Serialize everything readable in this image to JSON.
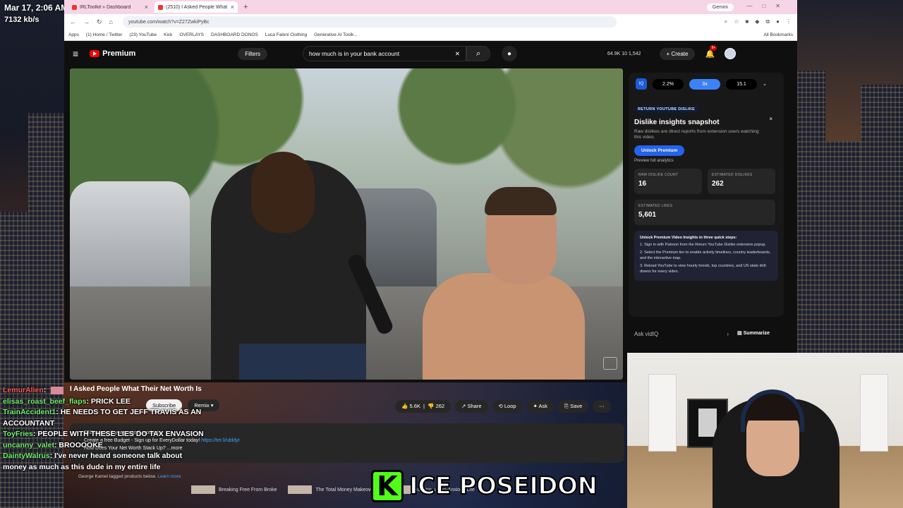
{
  "overlay": {
    "datetime": "Mar 17, 2:06 AM",
    "bitrate": "7132 kb/s"
  },
  "browser": {
    "tabs": [
      {
        "title": "IRLToolkit » Dashboard"
      },
      {
        "title": "(2510) I Asked People What Their Net Worth Is"
      }
    ],
    "gemini": "Gemini",
    "url": "youtube.com/watch?v=Z27ZwkiPyBc",
    "bookmarks": [
      "Apps",
      "(1) Home / Twitter",
      "(23) YouTube",
      "Kick",
      "OVERLAYS",
      "DASHBOARD DONOS",
      "Luca Faloni Clothing",
      "Generative AI Toolk..."
    ],
    "all_bookmarks": "All Bookmarks"
  },
  "youtube": {
    "logo": "Premium",
    "filters": "Filters",
    "search_value": "how much is in your bank account",
    "stats": "64.9K   10   1,542",
    "create": "Create",
    "notif_badge": "9+"
  },
  "video": {
    "title": "I Asked People What Their Net Worth Is",
    "channel": "George Kamel",
    "subscribe": "Subscribe",
    "remix": "Remix",
    "likes": "5.6K",
    "dislikes": "262",
    "share": "Share",
    "loop": "Loop",
    "ask": "Ask",
    "save": "Save",
    "desc_meta": "281K views  2 years ago  9 products",
    "desc_line": "Create a free Budget - Sign up for EveryDollar today!",
    "desc_link": "https://ter.li/ubldyt",
    "desc_more": "How Does Your Net Worth Stack Up?  ...more",
    "tagged": "George Kamel tagged products below.",
    "learn_more": "Learn more",
    "products": [
      "Breaking Free From Broke",
      "The Total Money Makeover",
      "Building a Non-Anxious Life"
    ]
  },
  "vidiq": {
    "logo": "IQ",
    "pills": [
      "2.2%",
      "3x",
      "15.1"
    ],
    "active_pill": 1
  },
  "ryd": {
    "tag": "RETURN YOUTUBE DISLIKE",
    "title": "Dislike insights snapshot",
    "sub": "Raw dislikes are direct reports from extension users watching this video.",
    "unlock": "Unlock Premium",
    "preview": "Preview full analytics",
    "raw_label": "RAW DISLIKE COUNT",
    "raw_val": "16",
    "est_dis_label": "ESTIMATED DISLIKES",
    "est_dis_val": "262",
    "est_like_label": "ESTIMATED LIKES",
    "est_like_val": "5,601",
    "steps_head": "Unlock Premium Video Insights in three quick steps:",
    "steps": [
      "1. Sign in with Patreon from the Return YouTube Dislike extension popup.",
      "2. Select the Premium tier to enable activity timelines, country leaderboards, and the interactive map.",
      "3. Reload YouTube to view hourly trends, top countries, and US state drill-downs for every video."
    ]
  },
  "ask": {
    "placeholder": "Ask vidIQ",
    "summarize": "Summarize"
  },
  "chat": [
    {
      "user": "LemurAlien",
      "msg": "",
      "red": true,
      "gift": true
    },
    {
      "user": "elisas_roast_beef_flaps",
      "msg": "PRICK LEE"
    },
    {
      "user": "TrainAccident1",
      "msg": "HE NEEDS TO GET JEFF TRAVIS AS AN ACCOUNTANT"
    },
    {
      "user": "ToyFries",
      "msg": "PEOPLE WITH THESE LIES DO TAX ENVASION"
    },
    {
      "user": "uncanny_valet",
      "msg": "BROOOOKE"
    },
    {
      "user": "DaintyWalrus",
      "msg": "I've never heard someone talk about money as much as this dude in my entire life"
    }
  ],
  "brand": {
    "k": "K",
    "name": "ICE POSEIDON"
  },
  "colors": {
    "kick_green": "#53fc18",
    "yt_red": "#ff0000",
    "chat_user": "#6ef26e"
  }
}
